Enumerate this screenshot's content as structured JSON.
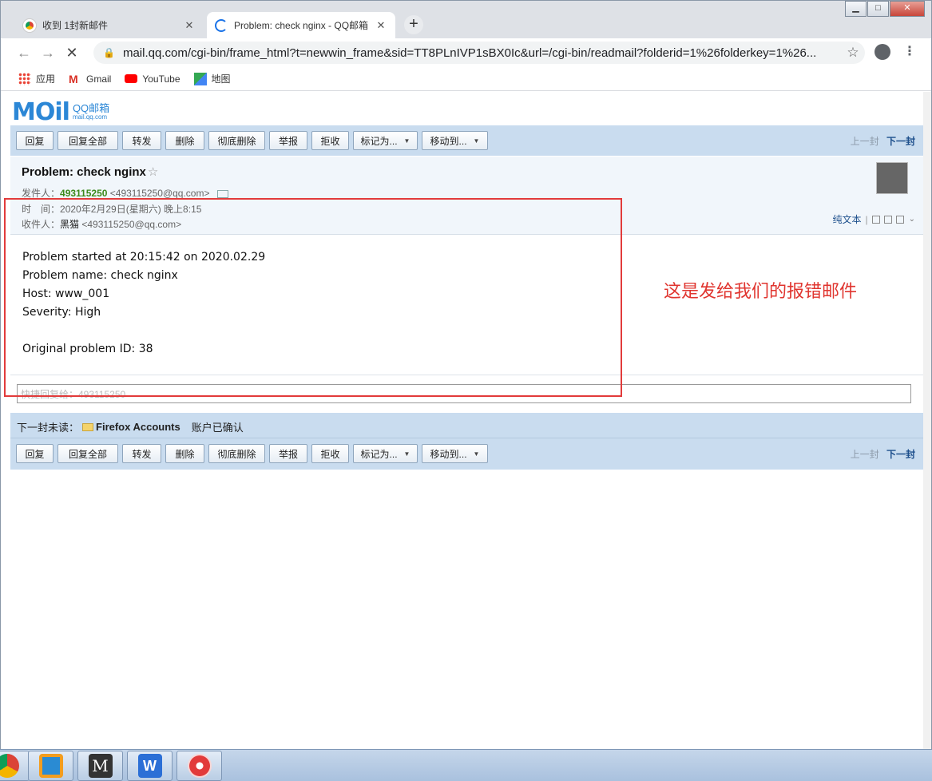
{
  "browser": {
    "tabs": [
      {
        "label": "收到 1封新邮件",
        "active": false
      },
      {
        "label": "Problem: check nginx - QQ邮箱",
        "active": true
      }
    ],
    "url": "mail.qq.com/cgi-bin/frame_html?t=newwin_frame&sid=TT8PLnIVP1sBX0Ic&url=/cgi-bin/readmail?folderid=1%26folderkey=1%26...",
    "bookmarks": [
      "应用",
      "Gmail",
      "YouTube",
      "地图"
    ]
  },
  "logo": {
    "main": "MOil",
    "cn": "QQ邮箱",
    "domain": "mail.qq.com"
  },
  "actions": {
    "reply": "回复",
    "reply_all": "回复全部",
    "forward": "转发",
    "delete": "删除",
    "delete_forever": "彻底删除",
    "report": "举报",
    "reject": "拒收",
    "mark_as": "标记为...",
    "move_to": "移动到...",
    "prev": "上一封",
    "next": "下一封"
  },
  "mail": {
    "subject": "Problem: check nginx",
    "star": "☆",
    "sender_label": "发件人：",
    "sender_name": "493115250",
    "sender_email": "<493115250@qq.com>",
    "time_label": "时　间：",
    "time": "2020年2月29日(星期六) 晚上8:15",
    "to_label": "收件人：",
    "to_name": "黑猫",
    "to_email": "<493115250@qq.com>",
    "plain_text": "纯文本",
    "body": [
      "Problem started at 20:15:42 on 2020.02.29",
      "Problem name: check nginx",
      "Host: www_001",
      "Severity: High",
      "",
      "Original problem ID: 38"
    ],
    "quick_reply_placeholder": "快捷回复给：493115250"
  },
  "next_unread": {
    "label": "下一封未读：",
    "sender": "Firefox Accounts",
    "subject": "账户已确认"
  },
  "annotation": "这是发给我们的报错邮件",
  "colors": {
    "red": "#e23b3b",
    "blue_bar": "#c9dcef",
    "sender_green": "#3c8a1b"
  }
}
